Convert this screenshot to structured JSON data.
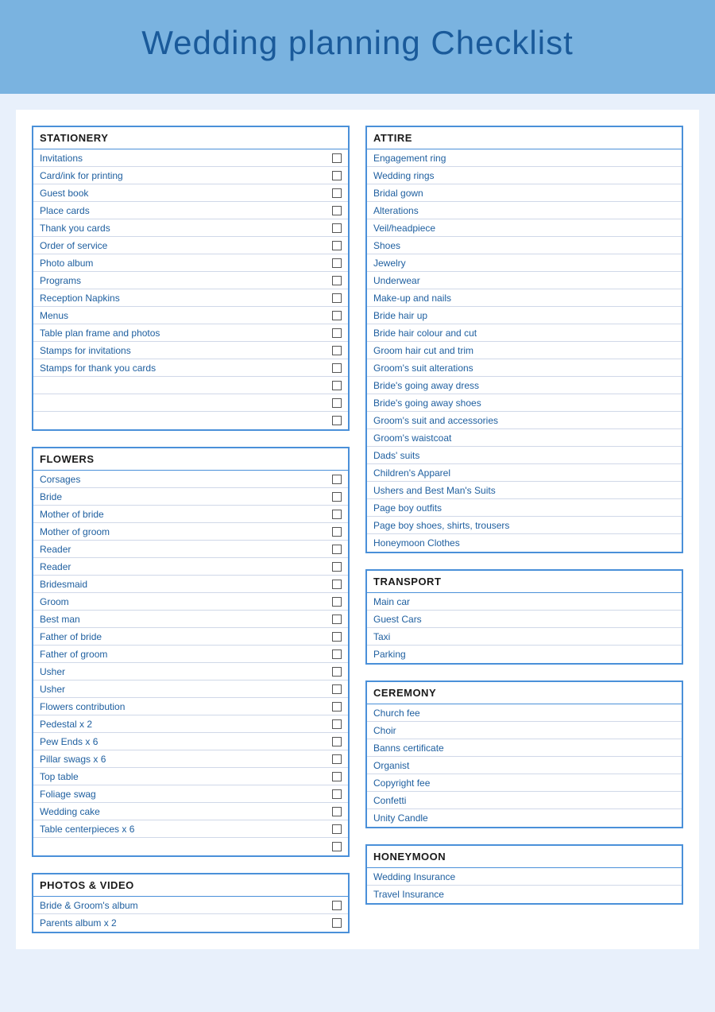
{
  "header": {
    "title": "Wedding planning Checklist"
  },
  "sections": {
    "stationery": {
      "title": "STATIONERY",
      "items": [
        "Invitations",
        "Card/ink for printing",
        "Guest book",
        "Place cards",
        "Thank you cards",
        "Order of service",
        "Photo album",
        "Programs",
        "Reception Napkins",
        "Menus",
        "Table plan frame and photos",
        "Stamps for invitations",
        "Stamps for thank you cards",
        "",
        "",
        ""
      ]
    },
    "attire": {
      "title": "ATTIRE",
      "items": [
        "Engagement ring",
        "Wedding rings",
        "Bridal gown",
        "Alterations",
        "Veil/headpiece",
        "Shoes",
        "Jewelry",
        "Underwear",
        "Make-up and nails",
        "Bride hair up",
        "Bride hair colour and cut",
        "Groom hair cut and trim",
        "Groom's suit alterations",
        "Bride's going away dress",
        "Bride's going away shoes",
        "Groom's suit and accessories",
        "Groom's waistcoat",
        "Dads' suits",
        "Children's Apparel",
        "Ushers and Best Man's Suits",
        "Page boy outfits",
        "Page boy shoes, shirts, trousers",
        "Honeymoon Clothes"
      ]
    },
    "flowers": {
      "title": "FLOWERS",
      "items": [
        "Corsages",
        "Bride",
        "Mother of bride",
        "Mother of groom",
        "Reader",
        "Reader",
        "Bridesmaid",
        "Groom",
        "Best man",
        "Father of bride",
        "Father of groom",
        "Usher",
        "Usher",
        "Flowers contribution",
        "Pedestal x 2",
        "Pew Ends x 6",
        "Pillar swags x 6",
        "Top table",
        "Foliage swag",
        "Wedding cake",
        "Table centerpieces x 6",
        ""
      ]
    },
    "transport": {
      "title": "TRANSPORT",
      "items": [
        "Main car",
        "Guest Cars",
        "Taxi",
        "Parking"
      ]
    },
    "ceremony": {
      "title": "CEREMONY",
      "items": [
        "Church fee",
        "Choir",
        "Banns certificate",
        "Organist",
        "Copyright fee",
        "Confetti",
        "Unity Candle"
      ]
    },
    "photos": {
      "title": "PHOTOS & VIDEO",
      "items": [
        "Bride & Groom's album",
        "Parents album x 2"
      ]
    },
    "honeymoon": {
      "title": "HONEYMOON",
      "items": [
        "Wedding Insurance",
        "Travel Insurance"
      ]
    }
  }
}
